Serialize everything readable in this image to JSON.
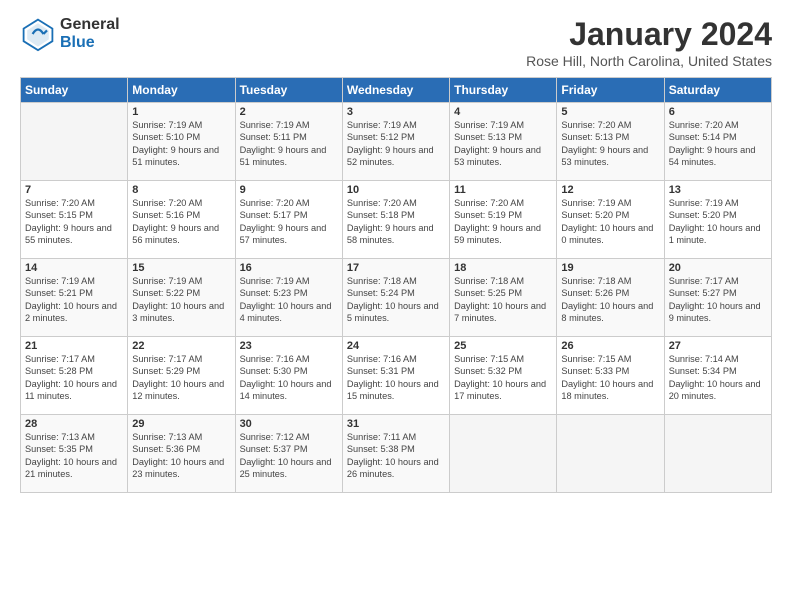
{
  "logo": {
    "general": "General",
    "blue": "Blue"
  },
  "title": "January 2024",
  "subtitle": "Rose Hill, North Carolina, United States",
  "headers": [
    "Sunday",
    "Monday",
    "Tuesday",
    "Wednesday",
    "Thursday",
    "Friday",
    "Saturday"
  ],
  "weeks": [
    [
      {
        "day": "",
        "sunrise": "",
        "sunset": "",
        "daylight": ""
      },
      {
        "day": "1",
        "sunrise": "Sunrise: 7:19 AM",
        "sunset": "Sunset: 5:10 PM",
        "daylight": "Daylight: 9 hours and 51 minutes."
      },
      {
        "day": "2",
        "sunrise": "Sunrise: 7:19 AM",
        "sunset": "Sunset: 5:11 PM",
        "daylight": "Daylight: 9 hours and 51 minutes."
      },
      {
        "day": "3",
        "sunrise": "Sunrise: 7:19 AM",
        "sunset": "Sunset: 5:12 PM",
        "daylight": "Daylight: 9 hours and 52 minutes."
      },
      {
        "day": "4",
        "sunrise": "Sunrise: 7:19 AM",
        "sunset": "Sunset: 5:13 PM",
        "daylight": "Daylight: 9 hours and 53 minutes."
      },
      {
        "day": "5",
        "sunrise": "Sunrise: 7:20 AM",
        "sunset": "Sunset: 5:13 PM",
        "daylight": "Daylight: 9 hours and 53 minutes."
      },
      {
        "day": "6",
        "sunrise": "Sunrise: 7:20 AM",
        "sunset": "Sunset: 5:14 PM",
        "daylight": "Daylight: 9 hours and 54 minutes."
      }
    ],
    [
      {
        "day": "7",
        "sunrise": "Sunrise: 7:20 AM",
        "sunset": "Sunset: 5:15 PM",
        "daylight": "Daylight: 9 hours and 55 minutes."
      },
      {
        "day": "8",
        "sunrise": "Sunrise: 7:20 AM",
        "sunset": "Sunset: 5:16 PM",
        "daylight": "Daylight: 9 hours and 56 minutes."
      },
      {
        "day": "9",
        "sunrise": "Sunrise: 7:20 AM",
        "sunset": "Sunset: 5:17 PM",
        "daylight": "Daylight: 9 hours and 57 minutes."
      },
      {
        "day": "10",
        "sunrise": "Sunrise: 7:20 AM",
        "sunset": "Sunset: 5:18 PM",
        "daylight": "Daylight: 9 hours and 58 minutes."
      },
      {
        "day": "11",
        "sunrise": "Sunrise: 7:20 AM",
        "sunset": "Sunset: 5:19 PM",
        "daylight": "Daylight: 9 hours and 59 minutes."
      },
      {
        "day": "12",
        "sunrise": "Sunrise: 7:19 AM",
        "sunset": "Sunset: 5:20 PM",
        "daylight": "Daylight: 10 hours and 0 minutes."
      },
      {
        "day": "13",
        "sunrise": "Sunrise: 7:19 AM",
        "sunset": "Sunset: 5:20 PM",
        "daylight": "Daylight: 10 hours and 1 minute."
      }
    ],
    [
      {
        "day": "14",
        "sunrise": "Sunrise: 7:19 AM",
        "sunset": "Sunset: 5:21 PM",
        "daylight": "Daylight: 10 hours and 2 minutes."
      },
      {
        "day": "15",
        "sunrise": "Sunrise: 7:19 AM",
        "sunset": "Sunset: 5:22 PM",
        "daylight": "Daylight: 10 hours and 3 minutes."
      },
      {
        "day": "16",
        "sunrise": "Sunrise: 7:19 AM",
        "sunset": "Sunset: 5:23 PM",
        "daylight": "Daylight: 10 hours and 4 minutes."
      },
      {
        "day": "17",
        "sunrise": "Sunrise: 7:18 AM",
        "sunset": "Sunset: 5:24 PM",
        "daylight": "Daylight: 10 hours and 5 minutes."
      },
      {
        "day": "18",
        "sunrise": "Sunrise: 7:18 AM",
        "sunset": "Sunset: 5:25 PM",
        "daylight": "Daylight: 10 hours and 7 minutes."
      },
      {
        "day": "19",
        "sunrise": "Sunrise: 7:18 AM",
        "sunset": "Sunset: 5:26 PM",
        "daylight": "Daylight: 10 hours and 8 minutes."
      },
      {
        "day": "20",
        "sunrise": "Sunrise: 7:17 AM",
        "sunset": "Sunset: 5:27 PM",
        "daylight": "Daylight: 10 hours and 9 minutes."
      }
    ],
    [
      {
        "day": "21",
        "sunrise": "Sunrise: 7:17 AM",
        "sunset": "Sunset: 5:28 PM",
        "daylight": "Daylight: 10 hours and 11 minutes."
      },
      {
        "day": "22",
        "sunrise": "Sunrise: 7:17 AM",
        "sunset": "Sunset: 5:29 PM",
        "daylight": "Daylight: 10 hours and 12 minutes."
      },
      {
        "day": "23",
        "sunrise": "Sunrise: 7:16 AM",
        "sunset": "Sunset: 5:30 PM",
        "daylight": "Daylight: 10 hours and 14 minutes."
      },
      {
        "day": "24",
        "sunrise": "Sunrise: 7:16 AM",
        "sunset": "Sunset: 5:31 PM",
        "daylight": "Daylight: 10 hours and 15 minutes."
      },
      {
        "day": "25",
        "sunrise": "Sunrise: 7:15 AM",
        "sunset": "Sunset: 5:32 PM",
        "daylight": "Daylight: 10 hours and 17 minutes."
      },
      {
        "day": "26",
        "sunrise": "Sunrise: 7:15 AM",
        "sunset": "Sunset: 5:33 PM",
        "daylight": "Daylight: 10 hours and 18 minutes."
      },
      {
        "day": "27",
        "sunrise": "Sunrise: 7:14 AM",
        "sunset": "Sunset: 5:34 PM",
        "daylight": "Daylight: 10 hours and 20 minutes."
      }
    ],
    [
      {
        "day": "28",
        "sunrise": "Sunrise: 7:13 AM",
        "sunset": "Sunset: 5:35 PM",
        "daylight": "Daylight: 10 hours and 21 minutes."
      },
      {
        "day": "29",
        "sunrise": "Sunrise: 7:13 AM",
        "sunset": "Sunset: 5:36 PM",
        "daylight": "Daylight: 10 hours and 23 minutes."
      },
      {
        "day": "30",
        "sunrise": "Sunrise: 7:12 AM",
        "sunset": "Sunset: 5:37 PM",
        "daylight": "Daylight: 10 hours and 25 minutes."
      },
      {
        "day": "31",
        "sunrise": "Sunrise: 7:11 AM",
        "sunset": "Sunset: 5:38 PM",
        "daylight": "Daylight: 10 hours and 26 minutes."
      },
      {
        "day": "",
        "sunrise": "",
        "sunset": "",
        "daylight": ""
      },
      {
        "day": "",
        "sunrise": "",
        "sunset": "",
        "daylight": ""
      },
      {
        "day": "",
        "sunrise": "",
        "sunset": "",
        "daylight": ""
      }
    ]
  ]
}
